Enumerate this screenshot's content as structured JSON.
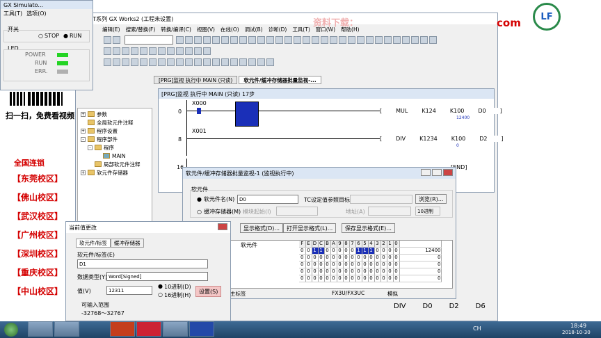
{
  "simulator": {
    "title": "GX Simulato...",
    "menu": [
      "工具(T)",
      "选项(O)"
    ],
    "switch_label": "开关",
    "stop": "STOP",
    "run": "RUN",
    "led_label": "LED",
    "power": "POWER",
    "run_led": "RUN",
    "err": "ERR."
  },
  "promo": {
    "qr_caption": "扫一扫，免费看视频",
    "chain": "全国连锁",
    "schools": [
      "【东莞校区】",
      "【佛山校区】",
      "【武汉校区】",
      "【广州校区】",
      "【深圳校区】",
      "【重庆校区】",
      "【中山校区】"
    ],
    "watermark": "资料下载：",
    "site": "com",
    "logo": "LF"
  },
  "main": {
    "title": "LSOFT系列 GX Works2 (工程未设置)",
    "menu": [
      "编辑(E)",
      "搜索/替换(F)",
      "转换/编译(C)",
      "视图(V)",
      "在线(O)",
      "调试(B)",
      "诊断(D)",
      "工具(T)",
      "窗口(W)",
      "帮助(H)"
    ],
    "tabs": [
      "[PRG]监视 执行中 MAIN (只读)",
      "软元件/缓冲存储器批量监视-..."
    ]
  },
  "tree": {
    "items": [
      "参数",
      "全局软元件注释",
      "程序设置",
      "程序部件",
      "程序",
      "MAIN",
      "局部软元件注释",
      "软元件存储器"
    ]
  },
  "ladder": {
    "title": "[PRG]监视 执行中 MAIN (只读) 17步",
    "rows": [
      {
        "step": "0",
        "contact": "X000",
        "instr": "MUL",
        "a": "K124",
        "b": "K100",
        "c": "D0",
        "val": "12400"
      },
      {
        "step": "8",
        "contact": "X001",
        "instr": "DIV",
        "a": "K1234",
        "b": "K100",
        "c": "D2",
        "val": "0"
      },
      {
        "step": "16",
        "instr": "END"
      }
    ]
  },
  "batch": {
    "title": "软元件/缓冲存储器批量监视-1 (监视执行中)",
    "group": "软元件",
    "device_name_label": "软元件名(N)",
    "device_value": "D0",
    "tc_label": "TC设定值参照目标",
    "browse": "浏览(R)...",
    "buffer_label": "缓冲存储器(M)",
    "module_label": "模块起始(I)",
    "address_label": "地址(A)",
    "radix": "10进制",
    "show_format": "显示格式(D)...",
    "open_format": "打开显示格式(L)...",
    "save_format": "保存显示格式(E)...",
    "col_device": "软元件",
    "bits": [
      "F",
      "E",
      "D",
      "C",
      "B",
      "A",
      "9",
      "8",
      "7",
      "6",
      "5",
      "4",
      "3",
      "2",
      "1",
      "0"
    ],
    "rows": [
      {
        "bits": "0011000001110000",
        "value": "12400"
      },
      {
        "bits": "0000000000000000",
        "value": "0"
      },
      {
        "bits": "0000000000000000",
        "value": "0"
      },
      {
        "bits": "0000000000000000",
        "value": "0"
      },
      {
        "bits": "0000000000000000",
        "value": "0"
      }
    ],
    "status_left": "主标签",
    "status_mid": "FX3U/FX3UC",
    "status_right": "模拟"
  },
  "dialog": {
    "title": "当前值更改",
    "tab1": "软元件/标签",
    "tab2": "缓冲存储器",
    "device_label": "软元件/标签(E)",
    "device_value": "D1",
    "type_label": "数据类型(Y)",
    "type_value": "Word[Signed]",
    "value_label": "值(V)",
    "value": "12311",
    "dec": "10进制(D)",
    "hex": "16进制(H)",
    "set": "设置(S)",
    "range_label": "可输入范围",
    "range": "-32768～32767"
  },
  "bottom": {
    "labels": [
      "DIV",
      "D0",
      "D2",
      "D6"
    ]
  },
  "taskbar": {
    "time": "18:49",
    "date": "2018-10-30",
    "ch": "CH"
  }
}
